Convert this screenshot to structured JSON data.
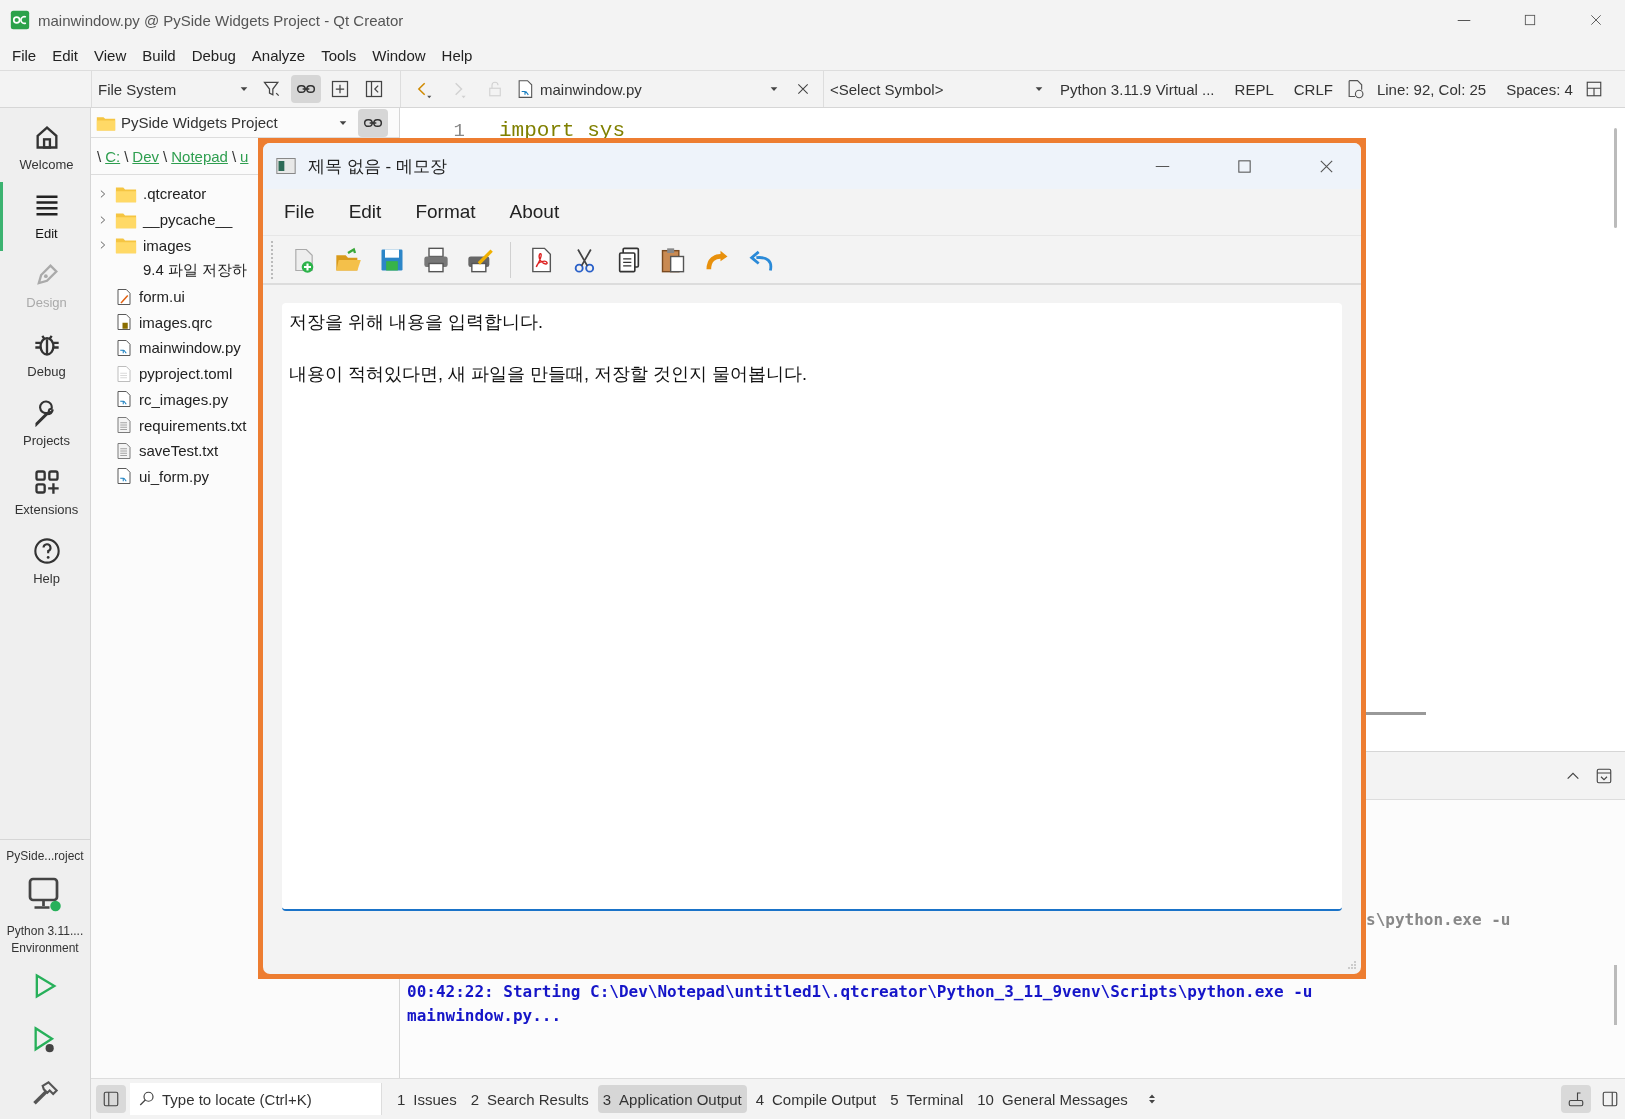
{
  "window": {
    "title": "mainwindow.py @ PySide Widgets Project - Qt Creator"
  },
  "menu": [
    "File",
    "Edit",
    "View",
    "Build",
    "Debug",
    "Analyze",
    "Tools",
    "Window",
    "Help"
  ],
  "sidebar_toolbar": {
    "view": "File System",
    "buttons": [
      {
        "kind": "filter",
        "selected": false
      },
      {
        "kind": "link",
        "selected": true
      },
      {
        "kind": "split",
        "selected": false
      },
      {
        "kind": "close-panel",
        "selected": false
      }
    ]
  },
  "editor_toolbar": {
    "nav": [
      {
        "kind": "back",
        "disabled": false
      },
      {
        "kind": "forward",
        "disabled": true
      },
      {
        "kind": "lock",
        "disabled": true
      }
    ],
    "file": "mainwindow.py",
    "symbol": "<Select Symbol>",
    "interpreter": "Python 3.11.9 Virtual ...",
    "repl": "REPL",
    "line_ending": "CRLF",
    "position": "Line: 92, Col: 25",
    "indent": "Spaces: 4"
  },
  "modes": [
    {
      "label": "Welcome",
      "kind": "home",
      "selected": false,
      "disabled": false
    },
    {
      "label": "Edit",
      "kind": "edit",
      "selected": true,
      "disabled": false
    },
    {
      "label": "Design",
      "kind": "design",
      "selected": false,
      "disabled": true
    },
    {
      "label": "Debug",
      "kind": "debug",
      "selected": false,
      "disabled": false
    },
    {
      "label": "Projects",
      "kind": "projects",
      "selected": false,
      "disabled": false
    },
    {
      "label": "Extensions",
      "kind": "extensions",
      "selected": false,
      "disabled": false
    },
    {
      "label": "Help",
      "kind": "help",
      "selected": false,
      "disabled": false
    }
  ],
  "target": {
    "project": "PySide...roject",
    "kit": [
      "Python 3.11....",
      "Environment"
    ]
  },
  "file_tree": {
    "project": "PySide Widgets Project",
    "breadcrumb": [
      {
        "text": "\\",
        "kind": "sep"
      },
      {
        "text": "C:",
        "kind": "link"
      },
      {
        "text": "\\",
        "kind": "sep"
      },
      {
        "text": "Dev",
        "kind": "link"
      },
      {
        "text": "\\",
        "kind": "sep"
      },
      {
        "text": "Notepad",
        "kind": "link"
      },
      {
        "text": "\\",
        "kind": "sep"
      },
      {
        "text": "u",
        "kind": "link"
      }
    ],
    "items": [
      {
        "name": ".qtcreator",
        "kind": "folder"
      },
      {
        "name": "__pycache__",
        "kind": "folder"
      },
      {
        "name": "images",
        "kind": "folder"
      },
      {
        "name": "9.4 파일 저장하",
        "kind": "plain"
      },
      {
        "name": "form.ui",
        "kind": "ui"
      },
      {
        "name": "images.qrc",
        "kind": "qrc"
      },
      {
        "name": "mainwindow.py",
        "kind": "py"
      },
      {
        "name": "pyproject.toml",
        "kind": "toml"
      },
      {
        "name": "rc_images.py",
        "kind": "py"
      },
      {
        "name": "requirements.txt",
        "kind": "txt"
      },
      {
        "name": "saveTest.txt",
        "kind": "txt"
      },
      {
        "name": "ui_form.py",
        "kind": "py"
      }
    ]
  },
  "editor": {
    "lines": [
      {
        "number": "1",
        "code": "import sys"
      }
    ]
  },
  "output": {
    "lines": [
      {
        "text": "s\\python.exe -u",
        "kind": "info"
      },
      {
        "text": "00:42:22: Starting C:\\Dev\\Notepad\\untitled1\\.qtcreator\\Python_3_11_9venv\\Scripts\\python.exe -u",
        "kind": "start"
      },
      {
        "text": "mainwindow.py...",
        "kind": "start"
      }
    ]
  },
  "locate": {
    "placeholder": "Type to locate (Ctrl+K)"
  },
  "output_tabs": [
    {
      "number": "1",
      "label": "Issues",
      "selected": false
    },
    {
      "number": "2",
      "label": "Search Results",
      "selected": false
    },
    {
      "number": "3",
      "label": "Application Output",
      "selected": true
    },
    {
      "number": "4",
      "label": "Compile Output",
      "selected": false
    },
    {
      "number": "5",
      "label": "Terminal",
      "selected": false
    },
    {
      "number": "10",
      "label": "General Messages",
      "selected": false
    }
  ],
  "notepad": {
    "title": "제목 없음 - 메모장",
    "menu": [
      "File",
      "Edit",
      "Format",
      "About"
    ],
    "toolbar": [
      {
        "kind": "new"
      },
      {
        "kind": "open"
      },
      {
        "kind": "save"
      },
      {
        "kind": "print"
      },
      {
        "kind": "print-preview"
      },
      {
        "kind": "separator"
      },
      {
        "kind": "pdf"
      },
      {
        "kind": "cut"
      },
      {
        "kind": "copy"
      },
      {
        "kind": "paste"
      },
      {
        "kind": "redo"
      },
      {
        "kind": "undo"
      }
    ],
    "paragraphs": [
      "저장을 위해 내용을 입력합니다.",
      "내용이 적혀있다면, 새 파일을 만들때, 저장할 것인지 물어봅니다."
    ]
  }
}
